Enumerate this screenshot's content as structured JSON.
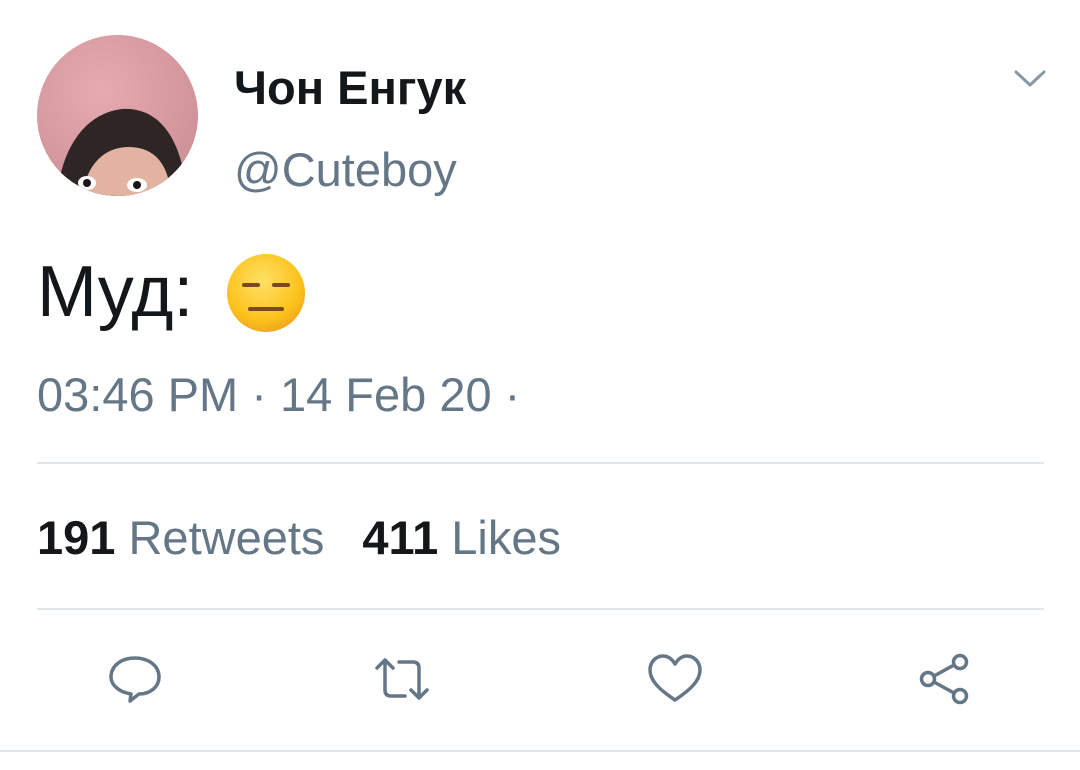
{
  "tweet": {
    "author_name": "Чон Енгук",
    "author_handle": "@Cuteboy",
    "text": "Муд:",
    "emoji_name": "expressionless-face",
    "timestamp": "03:46 PM · 14 Feb 20 ·"
  },
  "stats": {
    "retweets_count": "191",
    "retweets_label": "Retweets",
    "likes_count": "411",
    "likes_label": "Likes"
  },
  "icons": {
    "menu": "chevron-down-icon",
    "reply": "reply-icon",
    "retweet": "retweet-icon",
    "like": "heart-icon",
    "share": "share-icon"
  },
  "colors": {
    "text_primary": "#14171a",
    "text_secondary": "#657786",
    "divider": "#e1e8ed",
    "icon": "#657786"
  }
}
